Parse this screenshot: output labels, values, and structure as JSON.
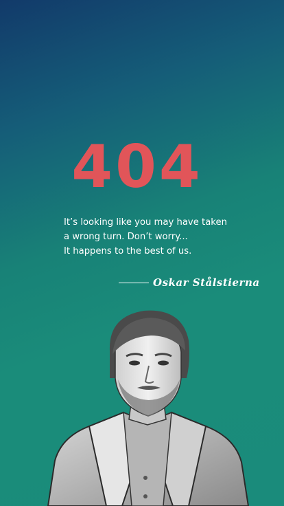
{
  "error": {
    "code": "404"
  },
  "message": {
    "lines": [
      "It’s looking like you may have taken",
      "a wrong turn. Don’t worry...",
      "It happens to the best of us."
    ]
  },
  "signature": {
    "name": "Oskar Stålstierna"
  },
  "colors": {
    "accent": "#e15559",
    "background_top": "#123a6a",
    "background_bottom": "#1a8b7b",
    "text": "#ffffff"
  },
  "portrait": {
    "icon": "person-photo-icon"
  }
}
